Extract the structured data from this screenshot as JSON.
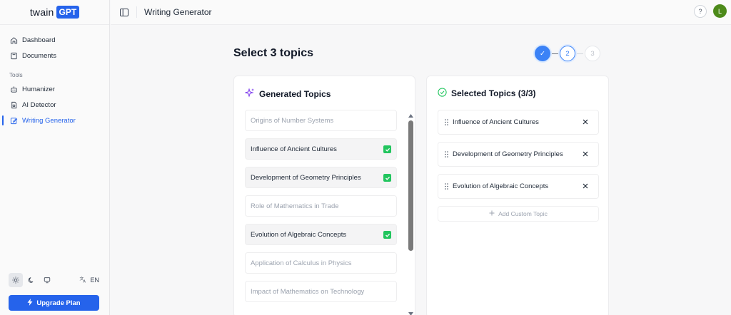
{
  "brand": {
    "word": "twain",
    "badge": "GPT"
  },
  "sidebar": {
    "items": [
      {
        "label": "Dashboard",
        "icon": "home-icon"
      },
      {
        "label": "Documents",
        "icon": "book-icon"
      }
    ],
    "tools_label": "Tools",
    "tools": [
      {
        "label": "Humanizer",
        "icon": "robot-icon"
      },
      {
        "label": "AI Detector",
        "icon": "file-scan-icon"
      },
      {
        "label": "Writing Generator",
        "icon": "pencil-square-icon",
        "active": true
      }
    ],
    "language": "EN",
    "upgrade_label": "Upgrade Plan"
  },
  "topbar": {
    "title": "Writing Generator",
    "help": "?",
    "avatar_initial": "L"
  },
  "main": {
    "heading": "Select 3 topics",
    "steps": [
      "✓",
      "2",
      "3"
    ],
    "generated": {
      "title": "Generated Topics",
      "topics": [
        {
          "label": "Origins of Number Systems",
          "selected": false
        },
        {
          "label": "Influence of Ancient Cultures",
          "selected": true
        },
        {
          "label": "Development of Geometry Principles",
          "selected": true
        },
        {
          "label": "Role of Mathematics in Trade",
          "selected": false
        },
        {
          "label": "Evolution of Algebraic Concepts",
          "selected": true
        },
        {
          "label": "Application of Calculus in Physics",
          "selected": false
        },
        {
          "label": "Impact of Mathematics on Technology",
          "selected": false
        }
      ]
    },
    "selected": {
      "title": "Selected Topics (3/3)",
      "items": [
        "Influence of Ancient Cultures",
        "Development of Geometry Principles",
        "Evolution of Algebraic Concepts"
      ],
      "add_custom_label": "Add Custom Topic"
    }
  },
  "colors": {
    "accent": "#2563eb",
    "success": "#22c55e",
    "avatar": "#4d8a1a"
  }
}
